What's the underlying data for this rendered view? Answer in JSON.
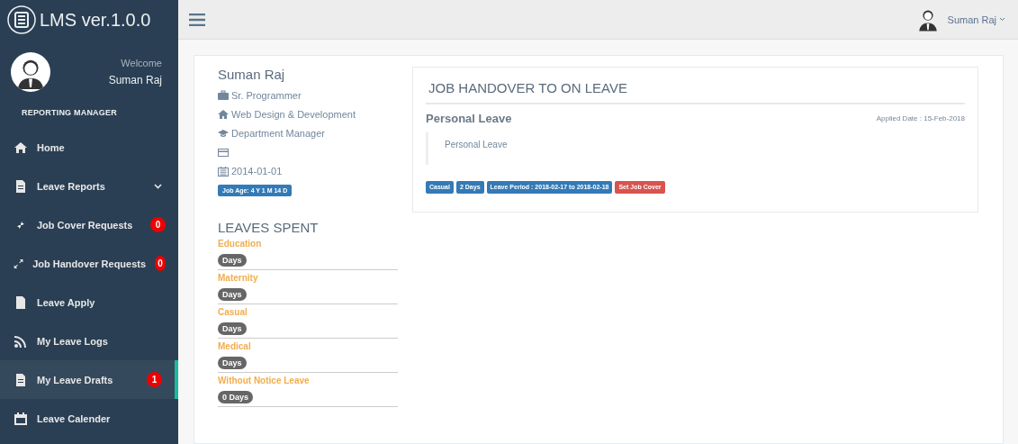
{
  "app": {
    "title": "LMS ver.1.0.0"
  },
  "sidebar": {
    "welcome": "Welcome",
    "user_name": "Suman Raj",
    "section_title": "REPORTING MANAGER",
    "items": [
      {
        "label": "Home",
        "selected": false
      },
      {
        "label": "Leave Reports",
        "selected": false,
        "submenu": true
      },
      {
        "label": "Job Cover Requests",
        "selected": false,
        "badge": "0"
      },
      {
        "label": "Job Handover Requests",
        "selected": false,
        "badge": "0"
      },
      {
        "label": "Leave Apply",
        "selected": false
      },
      {
        "label": "My Leave Logs",
        "selected": false
      },
      {
        "label": "My Leave Drafts",
        "selected": true,
        "badge": "1"
      },
      {
        "label": "Leave Calender",
        "selected": false
      }
    ]
  },
  "topbar": {
    "user_name": "Suman Raj"
  },
  "profile": {
    "name": "Suman Raj",
    "position": "Sr. Programmer",
    "department": "Web Design & Development",
    "role": "Department Manager",
    "join_date": "2014-01-01",
    "job_age": "Job Age: 4 Y 1 M 14 D"
  },
  "leaves_spent": {
    "title": "LEAVES SPENT",
    "items": [
      {
        "type": "Education",
        "days": "Days"
      },
      {
        "type": "Maternity",
        "days": "Days"
      },
      {
        "type": "Casual",
        "days": "Days"
      },
      {
        "type": "Medical",
        "days": "Days"
      },
      {
        "type": "Without Notice Leave",
        "days": "0 Days"
      }
    ]
  },
  "handover": {
    "title": "JOB HANDOVER TO ON LEAVE",
    "leave_title": "Personal Leave",
    "applied_date": "Applied Date : 15-Feb-2018",
    "reason": "Personal Leave",
    "tags": [
      {
        "label": "Casual",
        "kind": "info"
      },
      {
        "label": "2 Days",
        "kind": "info"
      },
      {
        "label": "Leave Period : 2018-02-17 to 2018-02-18",
        "kind": "info"
      },
      {
        "label": "Set Job Cover",
        "kind": "action"
      }
    ]
  }
}
